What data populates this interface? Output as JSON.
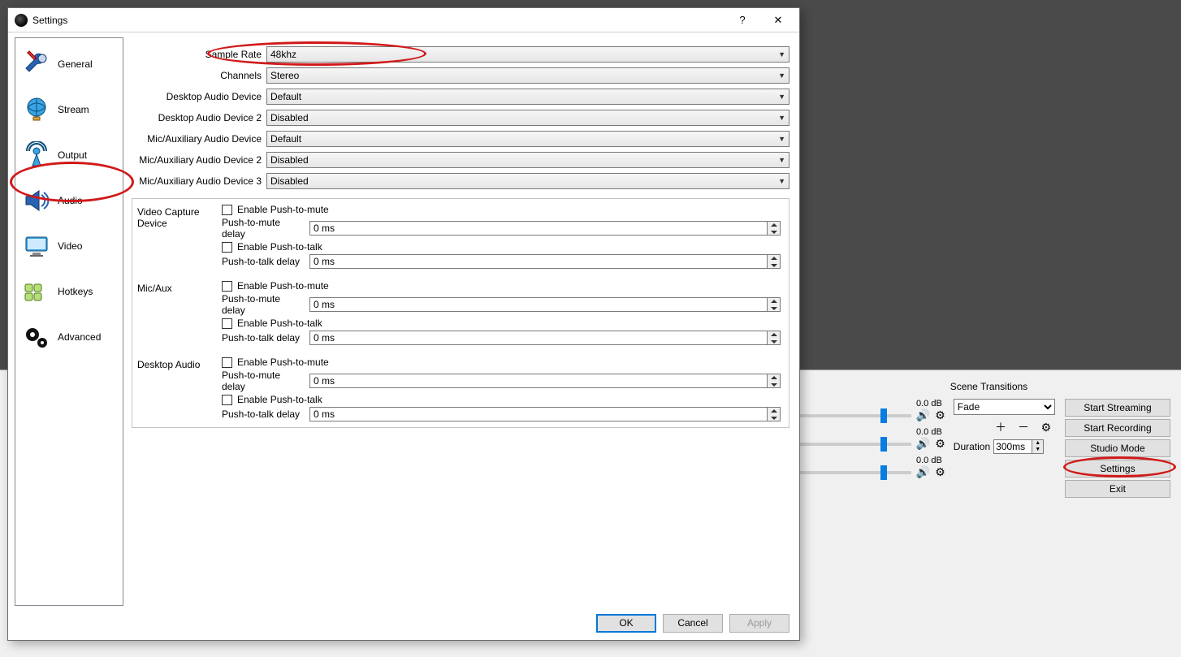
{
  "dialog": {
    "title": "Settings",
    "help_glyph": "?",
    "close_glyph": "✕",
    "sidebar": [
      {
        "key": "general",
        "label": "General"
      },
      {
        "key": "stream",
        "label": "Stream"
      },
      {
        "key": "output",
        "label": "Output"
      },
      {
        "key": "audio",
        "label": "Audio"
      },
      {
        "key": "video",
        "label": "Video"
      },
      {
        "key": "hotkeys",
        "label": "Hotkeys"
      },
      {
        "key": "advanced",
        "label": "Advanced"
      }
    ],
    "selected_sidebar": "audio",
    "dropdowns": [
      {
        "label": "Sample Rate",
        "value": "48khz"
      },
      {
        "label": "Channels",
        "value": "Stereo"
      },
      {
        "label": "Desktop Audio Device",
        "value": "Default"
      },
      {
        "label": "Desktop Audio Device 2",
        "value": "Disabled"
      },
      {
        "label": "Mic/Auxiliary Audio Device",
        "value": "Default"
      },
      {
        "label": "Mic/Auxiliary Audio Device 2",
        "value": "Disabled"
      },
      {
        "label": "Mic/Auxiliary Audio Device 3",
        "value": "Disabled"
      }
    ],
    "device_groups": [
      {
        "name": "Video Capture Device",
        "ptm_check": "Enable Push-to-mute",
        "ptm_delay_label": "Push-to-mute delay",
        "ptm_delay_value": "0 ms",
        "ptt_check": "Enable Push-to-talk",
        "ptt_delay_label": "Push-to-talk delay",
        "ptt_delay_value": "0 ms"
      },
      {
        "name": "Mic/Aux",
        "ptm_check": "Enable Push-to-mute",
        "ptm_delay_label": "Push-to-mute delay",
        "ptm_delay_value": "0 ms",
        "ptt_check": "Enable Push-to-talk",
        "ptt_delay_label": "Push-to-talk delay",
        "ptt_delay_value": "0 ms"
      },
      {
        "name": "Desktop Audio",
        "ptm_check": "Enable Push-to-mute",
        "ptm_delay_label": "Push-to-mute delay",
        "ptm_delay_value": "0 ms",
        "ptt_check": "Enable Push-to-talk",
        "ptt_delay_label": "Push-to-talk delay",
        "ptt_delay_value": "0 ms"
      }
    ],
    "buttons": {
      "ok": "OK",
      "cancel": "Cancel",
      "apply": "Apply"
    }
  },
  "main_window": {
    "scene_transitions_title": "Scene Transitions",
    "transition_value": "Fade",
    "duration_label": "Duration",
    "duration_value": "300ms",
    "buttons": {
      "start_streaming": "Start Streaming",
      "start_recording": "Start Recording",
      "studio_mode": "Studio Mode",
      "settings": "Settings",
      "exit": "Exit"
    },
    "mixer": [
      {
        "db": "0.0 dB"
      },
      {
        "db": "0.0 dB"
      },
      {
        "db": "0.0 dB"
      }
    ],
    "icons": {
      "plus": "＋",
      "minus": "－",
      "gear": "⚙",
      "speaker": "🔊"
    }
  }
}
